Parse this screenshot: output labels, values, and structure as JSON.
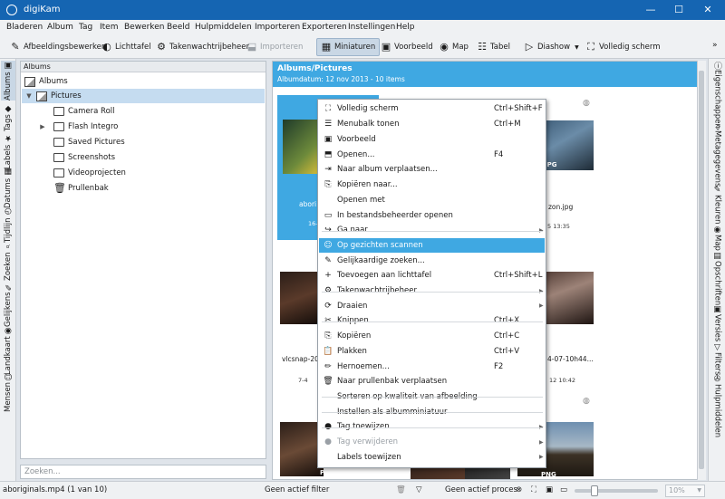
{
  "window": {
    "title": "digiKam",
    "min": "—",
    "max": "☐",
    "close": "✕"
  },
  "menu": [
    "Bladeren",
    "Album",
    "Tag",
    "Item",
    "Bewerken",
    "Beeld",
    "Hulpmiddelen",
    "Importeren",
    "Exporteren",
    "Instellingen",
    "Help"
  ],
  "toolbar": [
    {
      "label": "Afbeeldingsbewerker",
      "icon": "✎"
    },
    {
      "label": "Lichttafel",
      "icon": "◐"
    },
    {
      "label": "Takenwachtrijbeheer",
      "icon": "⚙"
    },
    {
      "label": "Importeren",
      "icon": "⬓"
    },
    {
      "label": "Miniaturen",
      "icon": "▦"
    },
    {
      "label": "Voorbeeld",
      "icon": "▣"
    },
    {
      "label": "Map",
      "icon": "◉"
    },
    {
      "label": "Tabel",
      "icon": "☷"
    },
    {
      "label": "Diashow",
      "icon": "▷"
    },
    {
      "label": "Volledig scherm",
      "icon": "⛶"
    }
  ],
  "left_tabs": [
    "Albums",
    "Tags",
    "Labels",
    "Datums",
    "Tijdlijn",
    "Zoeken",
    "Gelijkens",
    "Landkaart",
    "Mensen"
  ],
  "right_tabs": [
    "Eigenschappen",
    "Metagegevens",
    "Kleuren",
    "Map",
    "Opschriften",
    "Versies",
    "Filters",
    "Hulpmiddelen"
  ],
  "albums": {
    "header": "Albums",
    "items": [
      "Albums",
      "Pictures",
      "Camera Roll",
      "Flash Integro",
      "Saved Pictures",
      "Screenshots",
      "Videoprojecten",
      "Prullenbak"
    ],
    "search_placeholder": "Zoeken..."
  },
  "viewer": {
    "title": "Albums/Pictures",
    "subtitle": "Albumdatum: 12 nov 2013 - 10 items",
    "thumbs": [
      {
        "caption": "abori",
        "date": "16-"
      },
      {
        "caption": "zon.jpg",
        "date": "5 13:35"
      },
      {
        "caption": "vlcsnap-202",
        "date": "7-4"
      },
      {
        "caption": "4-07-10h44...",
        "date": "12 10:42"
      }
    ],
    "badges": [
      "PNG",
      "PNG",
      "PNG",
      "JPG"
    ]
  },
  "context_menu": [
    {
      "label": "Volledig scherm",
      "icon": "⛶",
      "shortcut": "Ctrl+Shift+F"
    },
    {
      "label": "Menubalk tonen",
      "icon": "☰",
      "shortcut": "Ctrl+M"
    },
    {
      "label": "Voorbeeld",
      "icon": "▣",
      "shortcut": ""
    },
    {
      "label": "Openen...",
      "icon": "⬒",
      "shortcut": "F4"
    },
    {
      "label": "Naar album verplaatsen...",
      "icon": "⇥",
      "shortcut": ""
    },
    {
      "label": "Kopiëren naar...",
      "icon": "⎘",
      "shortcut": ""
    },
    {
      "label": "Openen met",
      "icon": "",
      "shortcut": ""
    },
    {
      "label": "In bestandsbeheerder openen",
      "icon": "▭",
      "shortcut": ""
    },
    {
      "label": "Ga naar",
      "icon": "↪",
      "shortcut": ""
    },
    {
      "label": "Op gezichten scannen",
      "icon": "☺",
      "shortcut": ""
    },
    {
      "label": "Gelijkaardige zoeken...",
      "icon": "✎",
      "shortcut": ""
    },
    {
      "label": "Toevoegen aan lichttafel",
      "icon": "+",
      "shortcut": "Ctrl+Shift+L"
    },
    {
      "label": "Takenwachtrijbeheer",
      "icon": "⚙",
      "shortcut": ""
    },
    {
      "label": "Draaien",
      "icon": "⟳",
      "shortcut": ""
    },
    {
      "label": "Knippen",
      "icon": "✂",
      "shortcut": "Ctrl+X"
    },
    {
      "label": "Kopiëren",
      "icon": "⎘",
      "shortcut": "Ctrl+C"
    },
    {
      "label": "Plakken",
      "icon": "📋",
      "shortcut": "Ctrl+V"
    },
    {
      "label": "Hernoemen...",
      "icon": "✏",
      "shortcut": "F2"
    },
    {
      "label": "Naar prullenbak verplaatsen",
      "icon": "🗑",
      "shortcut": ""
    },
    {
      "label": "Sorteren op kwaliteit van afbeelding",
      "icon": "",
      "shortcut": ""
    },
    {
      "label": "Instellen als albumminiatuur",
      "icon": "",
      "shortcut": ""
    },
    {
      "label": "Tag toewijzen",
      "icon": "●",
      "shortcut": ""
    },
    {
      "label": "Tag verwijderen",
      "icon": "●",
      "shortcut": ""
    },
    {
      "label": "Labels toewijzen",
      "icon": "",
      "shortcut": ""
    }
  ],
  "status": {
    "left": "aboriginals.mp4 (1 van 10)",
    "filter": "Geen actief filter",
    "process": "Geen actief proces",
    "zoom": "10%"
  }
}
